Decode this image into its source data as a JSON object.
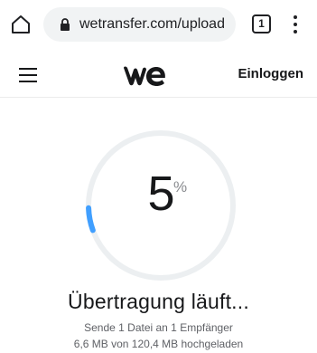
{
  "browser": {
    "url": "wetransfer.com/upload",
    "tab_count": "1",
    "icons": {
      "home": "home-icon",
      "lock": "lock-icon",
      "tabs": "tabs-icon",
      "menu": "more-vert-icon"
    }
  },
  "header": {
    "logo": "we",
    "login_label": "Einloggen",
    "menu_icon": "hamburger-icon"
  },
  "transfer": {
    "percent_value": "5",
    "percent_sign": "%",
    "progress_fraction": 0.05,
    "title": "Übertragung läuft...",
    "subtitle": "Sende 1 Datei an 1 Empfänger",
    "size_status": "6,6 MB von 120,4 MB hochgeladen"
  },
  "colors": {
    "ring_track": "#eceff1",
    "ring_progress": "#409fff",
    "text": "#17181a"
  }
}
